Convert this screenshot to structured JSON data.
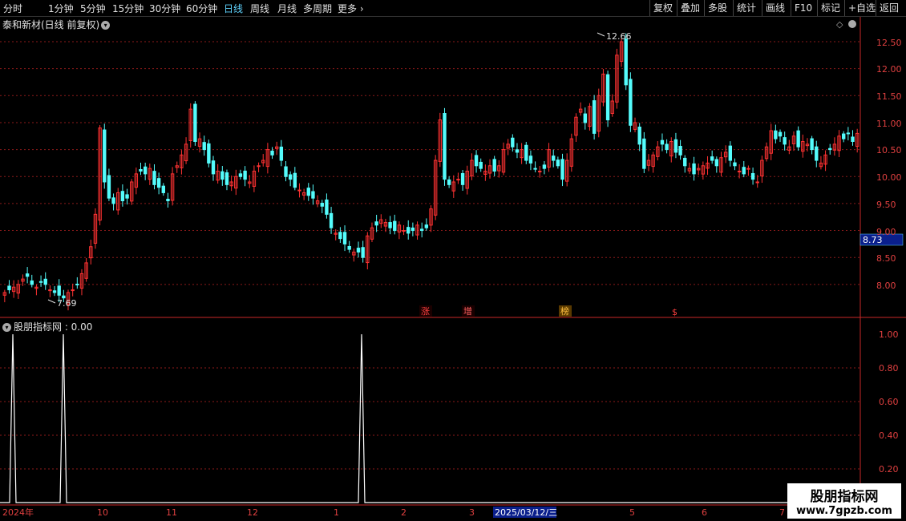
{
  "toolbar": {
    "periods": [
      "分时",
      "1分钟",
      "5分钟",
      "15分钟",
      "30分钟",
      "60分钟",
      "日线",
      "周线",
      "月线",
      "多周期",
      "更多"
    ],
    "active_period": "日线",
    "right_buttons": [
      "复权",
      "叠加",
      "多股",
      "统计",
      "画线",
      "F10",
      "标记",
      "+自选",
      "返回"
    ]
  },
  "stock": {
    "title": "泰和新材(日线 前复权)"
  },
  "price_axis": {
    "labels": [
      "12.50",
      "12.00",
      "11.50",
      "11.00",
      "10.50",
      "10.00",
      "9.50",
      "9.00",
      "8.50",
      "8.00"
    ],
    "current_price": "8.73"
  },
  "annotations": {
    "high": "12.66",
    "low": "7.69"
  },
  "markers": [
    "涨",
    "增",
    "榜",
    "$"
  ],
  "indicator": {
    "title": "股朋指标网 : 0.00",
    "axis_labels": [
      "1.00",
      "0.80",
      "0.60",
      "0.40",
      "0.20"
    ]
  },
  "date_axis": {
    "labels": [
      "2024年",
      "10",
      "11",
      "12",
      "1",
      "2",
      "3",
      "2025/03/12/三",
      "5",
      "6",
      "7"
    ]
  },
  "watermark": {
    "line1": "股朋指标网",
    "line2": "www.7gpzb.com"
  },
  "colors": {
    "up": "#ff3232",
    "down": "#54fcfc",
    "grid": "#8b1a1a",
    "axis": "#c82828",
    "highlight": "#0a1f8c"
  },
  "chart_data": {
    "type": "candlestick",
    "ylim": [
      7.5,
      12.85
    ],
    "dates_approx": [
      "2024-09",
      "2024-10",
      "2024-11",
      "2024-12",
      "2025-01",
      "2025-02",
      "2025-03",
      "2025-04",
      "2025-05",
      "2025-06",
      "2025-07"
    ],
    "close": [
      7.85,
      7.9,
      7.95,
      8.0,
      8.1,
      8.15,
      8.0,
      7.95,
      8.05,
      8.0,
      7.9,
      7.85,
      7.8,
      7.75,
      7.85,
      7.9,
      8.0,
      8.2,
      8.4,
      8.7,
      9.3,
      10.9,
      9.9,
      9.6,
      9.5,
      9.7,
      9.55,
      9.6,
      9.9,
      10.05,
      10.1,
      10.05,
      10.15,
      9.85,
      9.8,
      9.7,
      9.55,
      10.05,
      10.2,
      10.4,
      10.6,
      11.25,
      10.65,
      10.7,
      10.5,
      10.25,
      10.05,
      10.1,
      9.95,
      9.85,
      9.9,
      10.0,
      10.0,
      9.95,
      9.9,
      10.1,
      10.2,
      10.3,
      10.5,
      10.4,
      10.55,
      10.3,
      10.0,
      9.95,
      9.8,
      9.75,
      9.7,
      9.65,
      9.6,
      9.55,
      9.45,
      9.3,
      9.05,
      8.95,
      8.85,
      8.75,
      8.65,
      8.6,
      8.6,
      8.5,
      8.9,
      9.05,
      9.1,
      9.2,
      9.15,
      9.05,
      9.0,
      9.1,
      9.0,
      8.95,
      9.0,
      9.1,
      9.0,
      9.05,
      9.4,
      10.3,
      11.05,
      9.95,
      9.85,
      9.9,
      9.95,
      9.85,
      10.1,
      10.3,
      10.2,
      10.15,
      10.1,
      10.2,
      10.1,
      10.2,
      10.5,
      10.6,
      10.55,
      10.45,
      10.5,
      10.3,
      10.25,
      10.15,
      10.1,
      10.15,
      10.5,
      10.3,
      10.2,
      9.95,
      10.3,
      10.7,
      11.1,
      11.25,
      11.0,
      11.3,
      10.8,
      11.5,
      11.9,
      11.05,
      11.4,
      12.25,
      12.5,
      11.7,
      10.95,
      11.0,
      10.6,
      10.15,
      10.3,
      10.4,
      10.55,
      10.6,
      10.5,
      10.65,
      10.45,
      10.4,
      10.2,
      10.15,
      10.05,
      10.15,
      10.2,
      10.25,
      10.3,
      10.2,
      10.35,
      10.45,
      10.3,
      10.2,
      10.1,
      10.05,
      10.15,
      9.95,
      9.9,
      10.3,
      10.55,
      10.85,
      10.7,
      10.75,
      10.6,
      10.55,
      10.75,
      10.55,
      10.65,
      10.6,
      10.5,
      10.3,
      10.25,
      10.4,
      10.5,
      10.6,
      10.75,
      10.7,
      10.8,
      10.65,
      10.8
    ]
  }
}
